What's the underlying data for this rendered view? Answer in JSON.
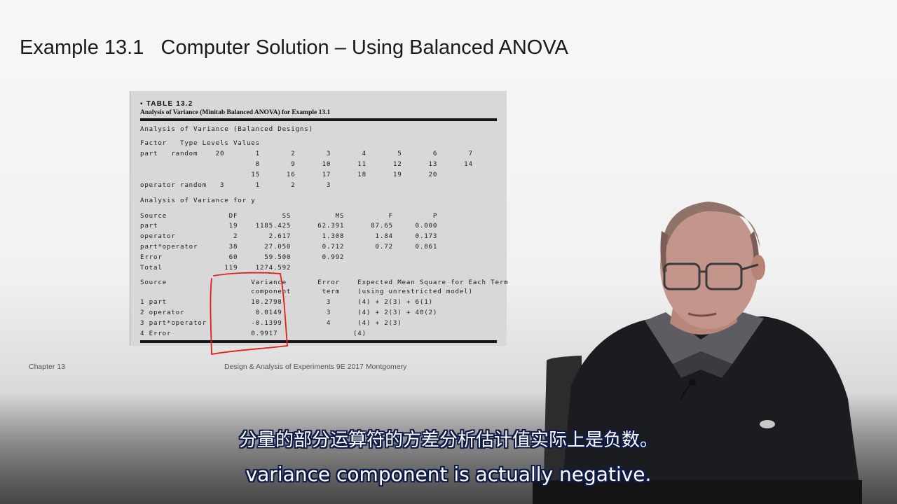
{
  "slide": {
    "title": "Example 13.1   Computer Solution – Using Balanced ANOVA",
    "footer_left": "Chapter 13",
    "footer_center": "Design & Analysis of Experiments 9E 2017 Montgomery"
  },
  "table": {
    "heading": "▪ TABLE 13.2",
    "caption": "Analysis of Variance (Minitab Balanced ANOVA) for Example 13.1",
    "section1_title": "Analysis of Variance (Balanced Designs)",
    "factor_header": "Factor   Type Levels Values",
    "factor_lines": [
      "part   random    20       1       2       3       4       5       6       7",
      "                          8       9      10      11      12      13      14",
      "                         15      16      17      18      19      20",
      "operator random   3       1       2       3"
    ],
    "section2_title": "Analysis of Variance for y",
    "anova_lines": [
      "Source              DF          SS          MS          F         P",
      "part                19    1185.425      62.391      87.65     0.000",
      "operator             2       2.617       1.308       1.84     0.173",
      "part*operator       38      27.050       0.712       0.72     0.861",
      "Error               60      59.500       0.992",
      "Total              119    1274.592"
    ],
    "component_lines": [
      "Source                   Variance       Error    Expected Mean Square for Each Term",
      "                         component       term    (using unrestricted model)",
      "1 part                   10.2798          3      (4) + 2(3) + 6(1)",
      "2 operator                0.0149          3      (4) + 2(3) + 40(2)",
      "3 part*operator          -0.1399          4      (4) + 2(3)",
      "4 Error                  0.9917                 (4)"
    ]
  },
  "subtitles": {
    "chinese": "分量的部分运算符的方差分析估计值实际上是负数。",
    "english": "variance component is actually negative."
  },
  "colors": {
    "annotation": "#e0201a",
    "subtitle_outline": "#0d1a4a"
  }
}
